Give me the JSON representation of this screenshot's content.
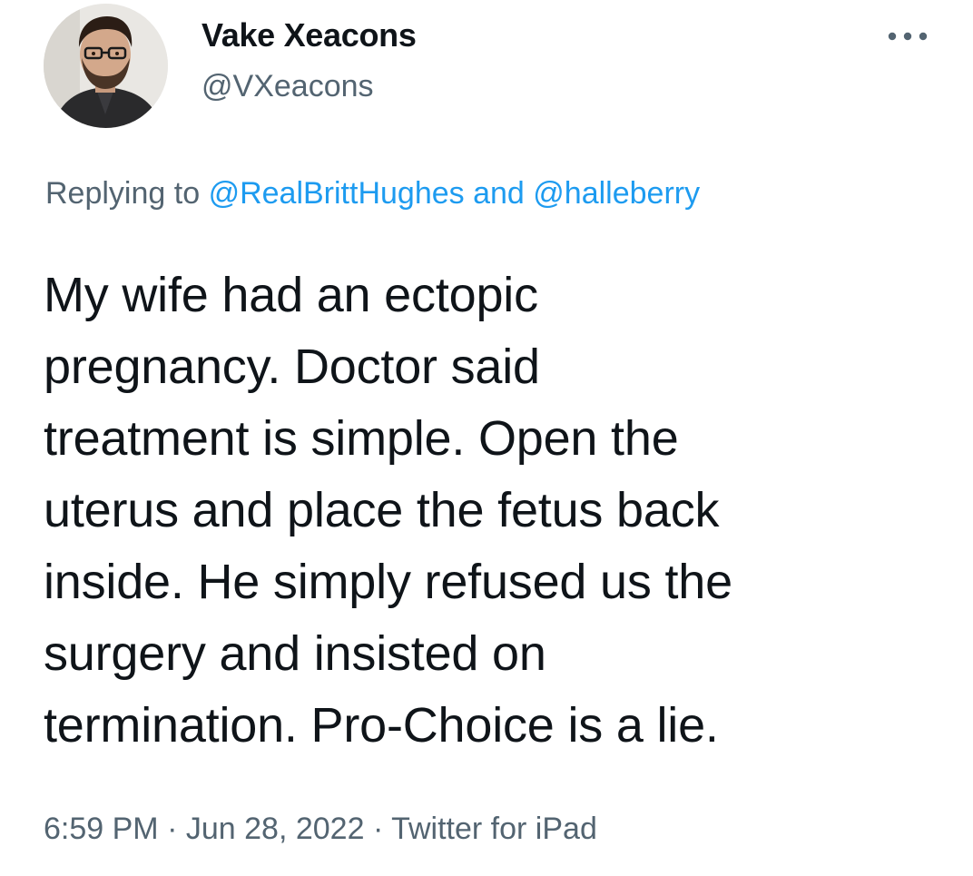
{
  "user": {
    "display_name": "Vake Xeacons",
    "handle": "@VXeacons",
    "avatar_icon": "avatar-photo"
  },
  "more_icon": "more-horizontal-icon",
  "reply": {
    "prefix": "Replying to",
    "mention_1": "@RealBrittHughes",
    "conjunction": "and",
    "mention_2": "@halleberry"
  },
  "tweet": {
    "lines": [
      "My wife had an ectopic",
      "pregnancy. Doctor said",
      "treatment is simple. Open the",
      "uterus and place the fetus back",
      "inside. He simply refused us the",
      "surgery and insisted on",
      "termination. Pro-Choice is a lie."
    ]
  },
  "meta": {
    "time": "6:59 PM",
    "separator": "·",
    "date": "Jun 28, 2022",
    "source": "Twitter for iPad"
  },
  "colors": {
    "text": "#0f1419",
    "secondary": "#536471",
    "link": "#1d9bf0"
  }
}
